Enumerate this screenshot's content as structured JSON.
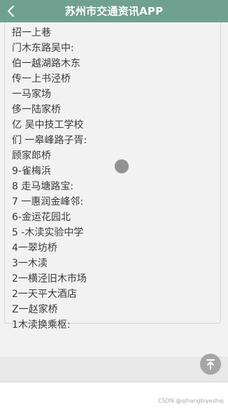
{
  "header": {
    "title": "苏州市交通资讯APP",
    "back_icon": "chevron-left-icon",
    "background_color": "#6fa090"
  },
  "stops": [
    "招一上巷",
    "门木东路吴中:",
    "伯一越湖路木东",
    "传一上书泾桥",
    "一马家场",
    "侈一陆家桥",
    "亿 吴中技工学校",
    "们 一皋峰路子胥:",
    "顾家郎桥",
    "9-雀梅浜",
    "8 走马塘路宝:",
    "7 一惠润金峰邻:",
    "6-金运花园北",
    "5 -木渎实验中学",
    "4一翠坊桥",
    "3一木渎",
    "2一横泾旧木市场",
    "2一天平大酒店",
    "Z一赵家桥",
    "1木渎换乘枢:"
  ],
  "back_to_top": {
    "icon": "arrow-up-to-top-icon"
  },
  "watermark": "CSDN @qihangbiyeshej"
}
